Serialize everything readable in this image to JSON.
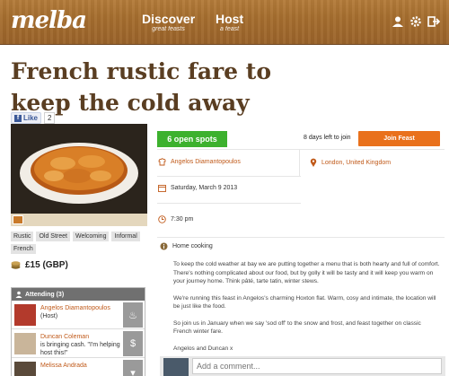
{
  "header": {
    "logo": "melba",
    "nav": [
      {
        "title": "Discover",
        "subtitle": "great feasts"
      },
      {
        "title": "Host",
        "subtitle": "a feast"
      }
    ],
    "icons": [
      "user-icon",
      "gear-icon",
      "logout-icon"
    ]
  },
  "event": {
    "title": "French rustic fare to keep the cold away",
    "like_label": "Like",
    "like_count": "2",
    "open_spots": "6 open spots",
    "days_left": "8 days left to join",
    "join_label": "Join Feast",
    "host_name": "Angelos Diamantopoulos",
    "location": "London, United Kingdom",
    "date": "Saturday, March 9 2013",
    "time": "7:30 pm",
    "tags": [
      "Rustic",
      "Old Street",
      "Welcoming",
      "Informal",
      "French"
    ],
    "price": "£15 (GBP)",
    "category": "Home cooking",
    "description": [
      "To keep the cold weather at bay we are putting together a menu that is both hearty and full of comfort. There's nothing complicated about our food, but by golly it will be tasty and it will keep you warm on your journey home. Think pâté, tarte tatin, winter stews.",
      "We're running this feast in Angelos's charming Hoxton flat. Warm, cosy and intimate, the location will be just like the food.",
      "So join us in January when we say 'sod off' to the snow and frost, and feast together on classic French winter fare.",
      "Angelos and Duncan x"
    ]
  },
  "attending": {
    "header": "Attending (3)",
    "people": [
      {
        "name": "Angelos Diamantopoulos",
        "note": "(Host)"
      },
      {
        "name": "Duncan Coleman",
        "note": "is bringing cash. \"I'm helping host this!\""
      },
      {
        "name": "Melissa Andrada",
        "note": ""
      }
    ]
  },
  "comment": {
    "placeholder": "Add a comment..."
  },
  "colors": {
    "header_wood": "#a66e2f",
    "title": "#5a3e22",
    "spots_green": "#3db12e",
    "join_orange": "#e9711c",
    "link": "#c05a1a"
  }
}
